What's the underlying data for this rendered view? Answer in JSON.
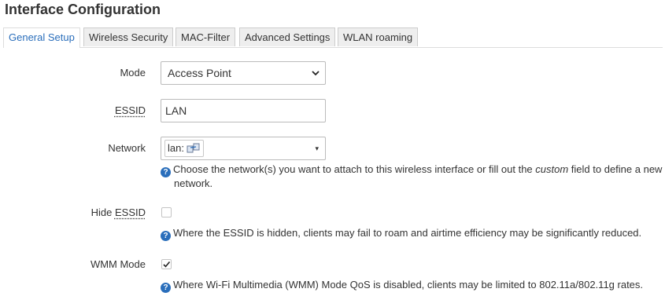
{
  "page": {
    "title": "Interface Configuration"
  },
  "tabs": [
    {
      "label": "General Setup",
      "active": true
    },
    {
      "label": "Wireless Security",
      "active": false
    },
    {
      "label": "MAC-Filter",
      "active": false
    },
    {
      "label": "Advanced Settings",
      "active": false
    },
    {
      "label": "WLAN roaming",
      "active": false
    }
  ],
  "form": {
    "mode": {
      "label": "Mode",
      "value": "Access Point"
    },
    "essid": {
      "label": "ESSID",
      "value": "LAN"
    },
    "network": {
      "label": "Network",
      "selected": "lan:",
      "chip_icon": "network-interfaces-icon",
      "help_before": "Choose the network(s) you want to attach to this wireless interface or fill out the ",
      "help_em": "custom",
      "help_after": " field to define a new",
      "help_line2": "network."
    },
    "hide_essid": {
      "label_prefix": "Hide ",
      "label_abbr": "ESSID",
      "checked": false,
      "help": "Where the ESSID is hidden, clients may fail to roam and airtime efficiency may be significantly reduced."
    },
    "wmm_mode": {
      "label": "WMM Mode",
      "checked": true,
      "help": "Where Wi-Fi Multimedia (WMM) Mode QoS is disabled, clients may be limited to 802.11a/802.11g rates."
    }
  },
  "icons": {
    "help": "question-icon",
    "help_glyph": "?",
    "chevron": "chevron-down-icon",
    "dropdown_arrow": "▾",
    "checkmark": "checkmark-icon"
  },
  "colors": {
    "accent": "#2a6ebb",
    "text": "#333333",
    "border": "#bbbbbb"
  }
}
